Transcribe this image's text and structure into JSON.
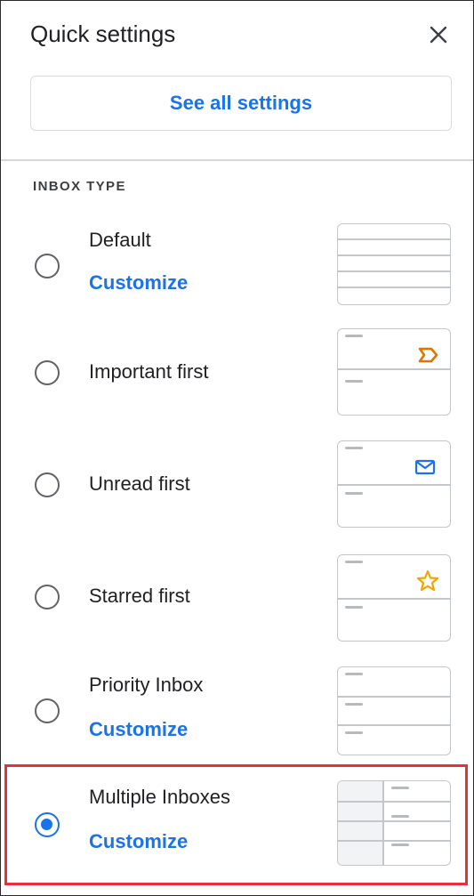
{
  "header": {
    "title": "Quick settings",
    "see_all_label": "See all settings"
  },
  "section": {
    "label": "INBOX TYPE"
  },
  "options": [
    {
      "label": "Default",
      "customize": "Customize",
      "selected": false
    },
    {
      "label": "Important first",
      "selected": false
    },
    {
      "label": "Unread first",
      "selected": false
    },
    {
      "label": "Starred first",
      "selected": false
    },
    {
      "label": "Priority Inbox",
      "customize": "Customize",
      "selected": false
    },
    {
      "label": "Multiple Inboxes",
      "customize": "Customize",
      "selected": true
    }
  ],
  "colors": {
    "accent": "#1a73e8",
    "important_icon": "#e37400",
    "star_icon": "#f2a600",
    "highlight": "#e8303a"
  },
  "icons": {
    "close": "close-icon",
    "important": "important-marker-icon",
    "unread": "envelope-icon",
    "starred": "star-icon"
  }
}
